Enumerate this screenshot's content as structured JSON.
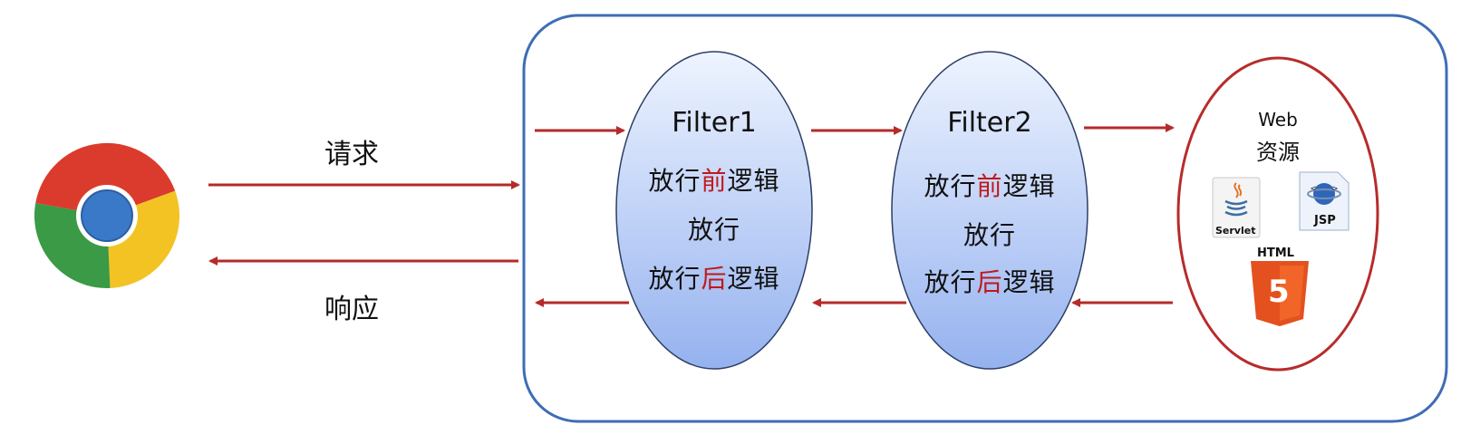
{
  "browser": {
    "icon": "chrome-icon"
  },
  "request": {
    "label": "请求"
  },
  "response": {
    "label": "响应"
  },
  "filters": [
    {
      "title": "Filter1",
      "line1_pre": "放行",
      "line1_hl": "前",
      "line1_post": "逻辑",
      "line2": "放行",
      "line3_pre": "放行",
      "line3_hl": "后",
      "line3_post": "逻辑"
    },
    {
      "title": "Filter2",
      "line1_pre": "放行",
      "line1_hl": "前",
      "line1_post": "逻辑",
      "line2": "放行",
      "line3_pre": "放行",
      "line3_hl": "后",
      "line3_post": "逻辑"
    }
  ],
  "web_resource": {
    "title_line1": "Web",
    "title_line2": "资源",
    "servlet_label": "Servlet",
    "jsp_label": "JSP",
    "html_label": "HTML",
    "html5_digit": "5"
  },
  "colors": {
    "container_border": "#3e6db5",
    "arrow": "#b52a2a",
    "web_ellipse": "#b82b2b",
    "filter_fill_top": "#e6efff",
    "filter_fill_bottom": "#97b4f0",
    "filter_stroke": "#2c3e64"
  }
}
